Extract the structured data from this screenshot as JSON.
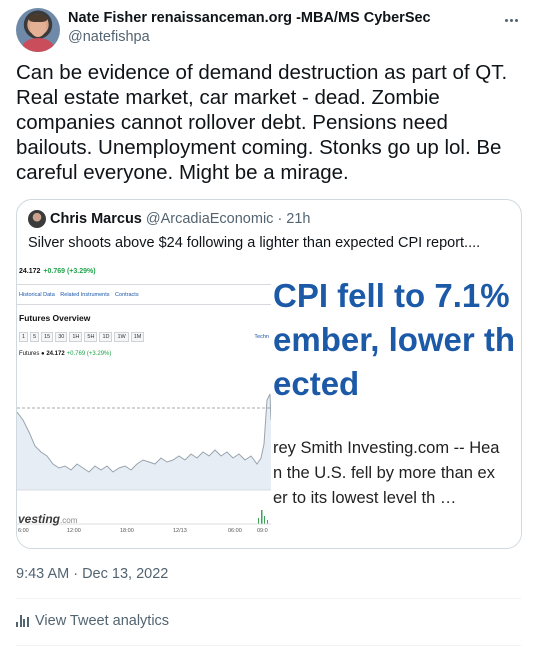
{
  "author": {
    "display_name": "Nate Fisher renaissanceman.org -MBA/MS CyberSec",
    "handle": "@natefishpa"
  },
  "tweet": {
    "text": "Can be evidence of demand destruction as part of QT. Real estate market, car market - dead. Zombie companies cannot rollover debt. Pensions need bailouts. Unemployment coming. Stonks go up lol. Be careful everyone. Might be a mirage.",
    "timestamp": "9:43 AM · Dec 13, 2022"
  },
  "quoted": {
    "display_name": "Chris Marcus",
    "handle": "@ArcadiaEconomic",
    "age": "· 21h",
    "text": "Silver shoots above $24 following a lighter than expected CPI report....",
    "chart_shot": {
      "price": "24.172",
      "change": "+0.769 (+3.29%)",
      "nav_links": [
        "Historical Data",
        "Related Instruments",
        "Contracts"
      ],
      "section_title": "Futures Overview",
      "ranges": [
        "1",
        "5",
        "15",
        "30",
        "1H",
        "5H",
        "1D",
        "1W",
        "1M"
      ],
      "technical_link": "Techn",
      "futures_label": "Futures",
      "futures_price": "24.172",
      "futures_change": "+0.769 (+3.29%)",
      "watermark": "vesting",
      "watermark_suffix": ".com",
      "x_ticks": [
        "6:00",
        "12:00",
        "18:00",
        "12/13",
        "06:00",
        "09:0"
      ]
    },
    "article": {
      "headline_lines": [
        "CPI fell to 7.1%",
        "ember, lower th",
        "ected"
      ],
      "body_lines": [
        "rey Smith  Investing.com -- Hea",
        "n the U.S. fell by more than ex",
        "er to its lowest level th  …"
      ]
    }
  },
  "footer": {
    "analytics_label": "View Tweet analytics"
  },
  "icons": {
    "more": "more-horizontal-icon",
    "analytics": "analytics-bars-icon"
  },
  "colors": {
    "text": "#0f1419",
    "secondary": "#536471",
    "border": "#cfd9de",
    "headline_blue": "#1c5aa8",
    "gain_green": "#21a34a"
  }
}
